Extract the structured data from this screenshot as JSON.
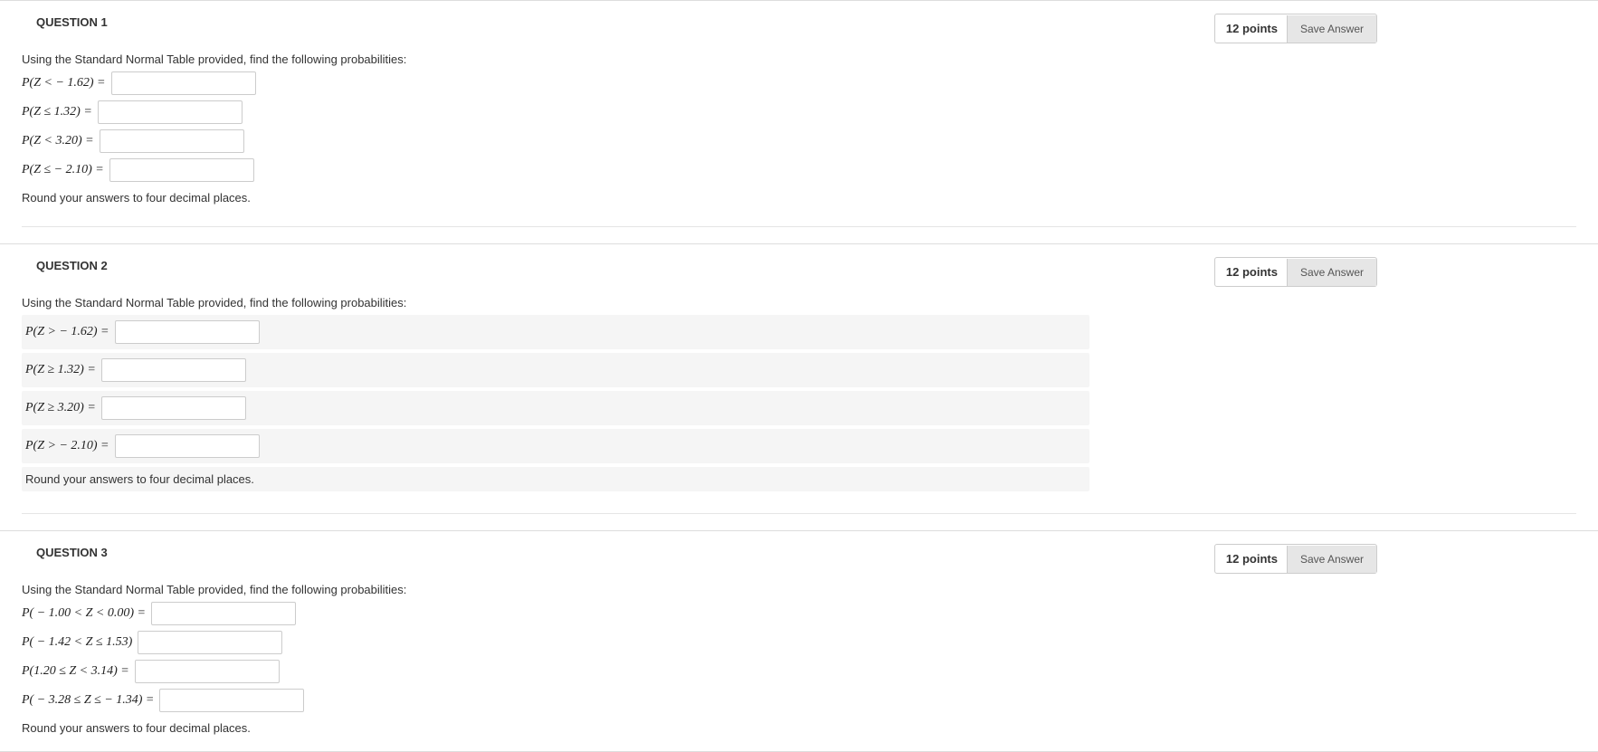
{
  "common": {
    "save_label": "Save Answer",
    "round_note": "Round your answers to four decimal places.",
    "intro": "Using the Standard Normal Table provided, find the following probabilities:"
  },
  "q1": {
    "title": "QUESTION 1",
    "points": "12 points",
    "rows": [
      {
        "expr_html": "P(Z < − 1.62) ="
      },
      {
        "expr_html": "P(Z ≤ 1.32) ="
      },
      {
        "expr_html": "P(Z < 3.20) ="
      },
      {
        "expr_html": "P(Z ≤ − 2.10) ="
      }
    ]
  },
  "q2": {
    "title": "QUESTION 2",
    "points": "12 points",
    "rows": [
      {
        "expr_html": "P(Z > − 1.62) ="
      },
      {
        "expr_html": "P(Z ≥ 1.32) ="
      },
      {
        "expr_html": "P(Z ≥ 3.20) ="
      },
      {
        "expr_html": "P(Z > − 2.10) ="
      }
    ]
  },
  "q3": {
    "title": "QUESTION 3",
    "points": "12 points",
    "rows": [
      {
        "expr_html": "P( − 1.00 < Z < 0.00) ="
      },
      {
        "expr_html": "P( − 1.42 < Z ≤ 1.53)"
      },
      {
        "expr_html": "P(1.20 ≤ Z < 3.14) ="
      },
      {
        "expr_html": "P( − 3.28 ≤ Z ≤ − 1.34) ="
      }
    ]
  }
}
